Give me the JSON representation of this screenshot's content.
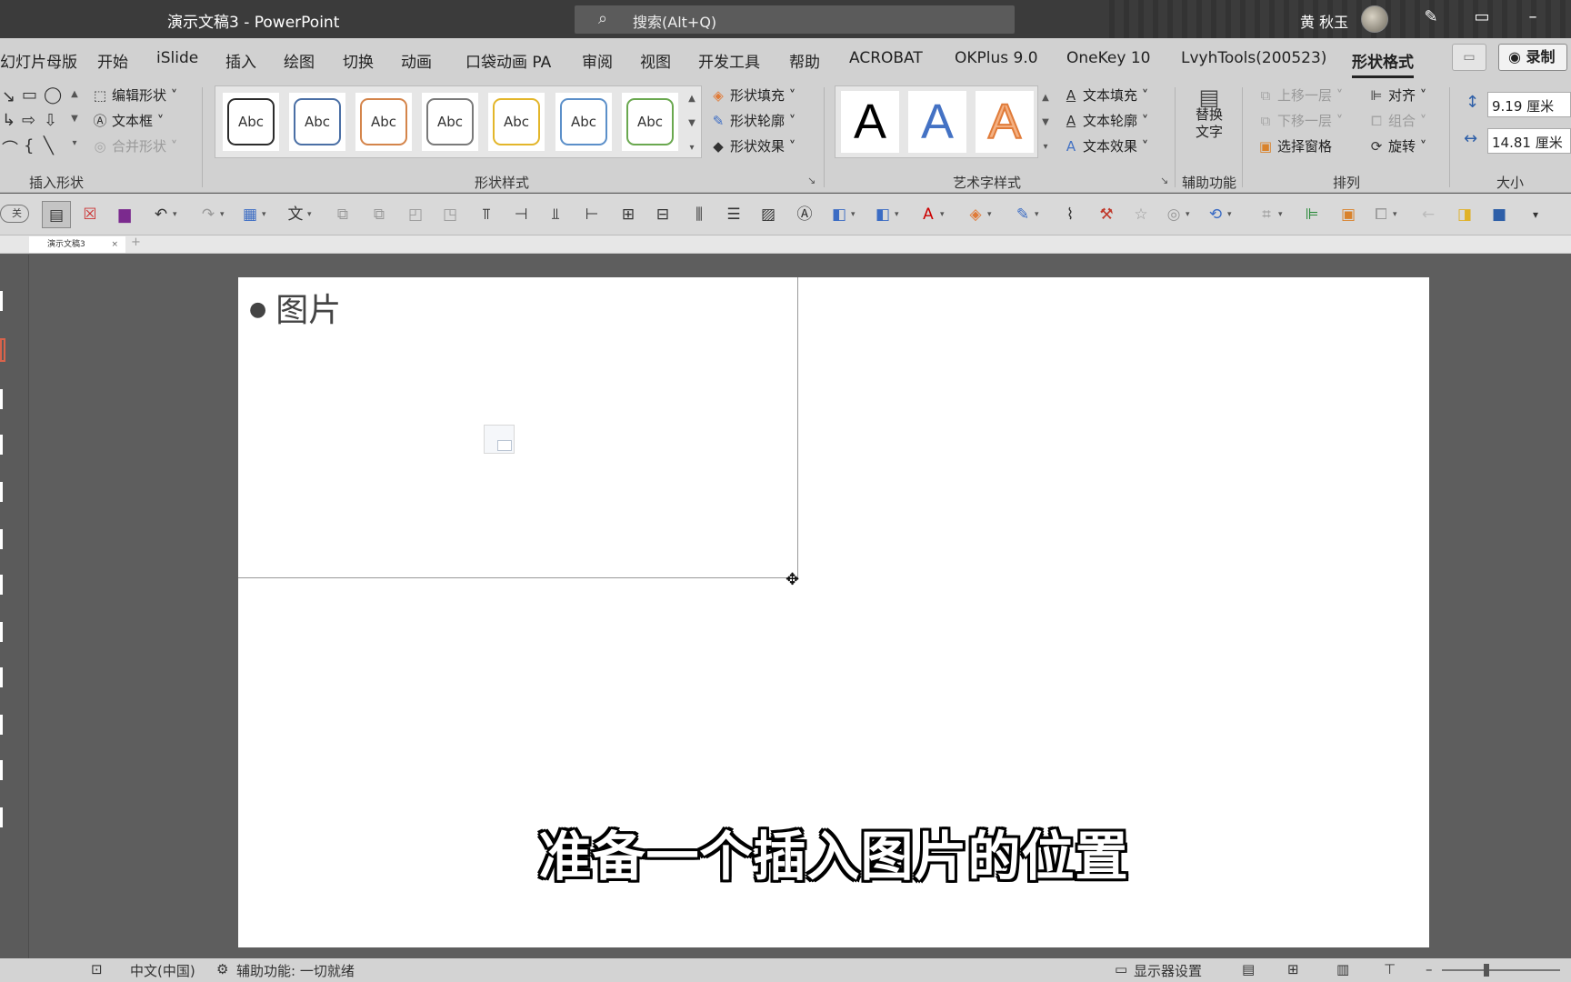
{
  "window": {
    "title": "演示文稿3  -  PowerPoint",
    "search_placeholder": "搜索(Alt+Q)",
    "user_name": "黄 秋玉"
  },
  "tabs": [
    {
      "label": "幻灯片母版"
    },
    {
      "label": "开始"
    },
    {
      "label": "iSlide"
    },
    {
      "label": "插入"
    },
    {
      "label": "绘图"
    },
    {
      "label": "切换"
    },
    {
      "label": "动画"
    },
    {
      "label": "口袋动画 PA"
    },
    {
      "label": "审阅"
    },
    {
      "label": "视图"
    },
    {
      "label": "开发工具"
    },
    {
      "label": "帮助"
    },
    {
      "label": "ACROBAT"
    },
    {
      "label": "OKPlus 9.0"
    },
    {
      "label": "OneKey 10"
    },
    {
      "label": "LvyhTools(200523)"
    },
    {
      "label": "形状格式",
      "active": true
    }
  ],
  "record_label": "录制",
  "ribbon": {
    "insert_shapes": {
      "group_label": "插入形状",
      "edit_shape": "编辑形状",
      "text_box": "文本框",
      "merge_shapes": "合并形状"
    },
    "shape_styles": {
      "group_label": "形状样式",
      "sample_text": "Abc",
      "swatches": [
        "#2b2b2b",
        "#4a6fa5",
        "#d4844a",
        "#7a7a7a",
        "#e3b62a",
        "#5b8fc9",
        "#6aa84f"
      ],
      "fill": "形状填充",
      "outline": "形状轮廓",
      "effects": "形状效果"
    },
    "wordart": {
      "group_label": "艺术字样式",
      "letter": "A",
      "text_fill": "文本填充",
      "text_outline": "文本轮廓",
      "text_effects": "文本效果"
    },
    "accessibility": {
      "group_label": "辅助功能",
      "alt_text_line1": "替换",
      "alt_text_line2": "文字"
    },
    "arrange": {
      "group_label": "排列",
      "bring_forward": "上移一层",
      "send_backward": "下移一层",
      "selection_pane": "选择窗格",
      "align": "对齐",
      "group": "组合",
      "rotate": "旋转"
    },
    "size": {
      "group_label": "大小",
      "height": "9.19 厘米",
      "width": "14.81 厘米"
    }
  },
  "qat_close_label": "关",
  "doc_tab": "演示文稿3",
  "slide": {
    "bullet_text": "图片",
    "caption": "准备一个插入图片的位置"
  },
  "status": {
    "language": "中文(中国)",
    "accessibility": "辅助功能: 一切就绪",
    "display_settings": "显示器设置"
  }
}
